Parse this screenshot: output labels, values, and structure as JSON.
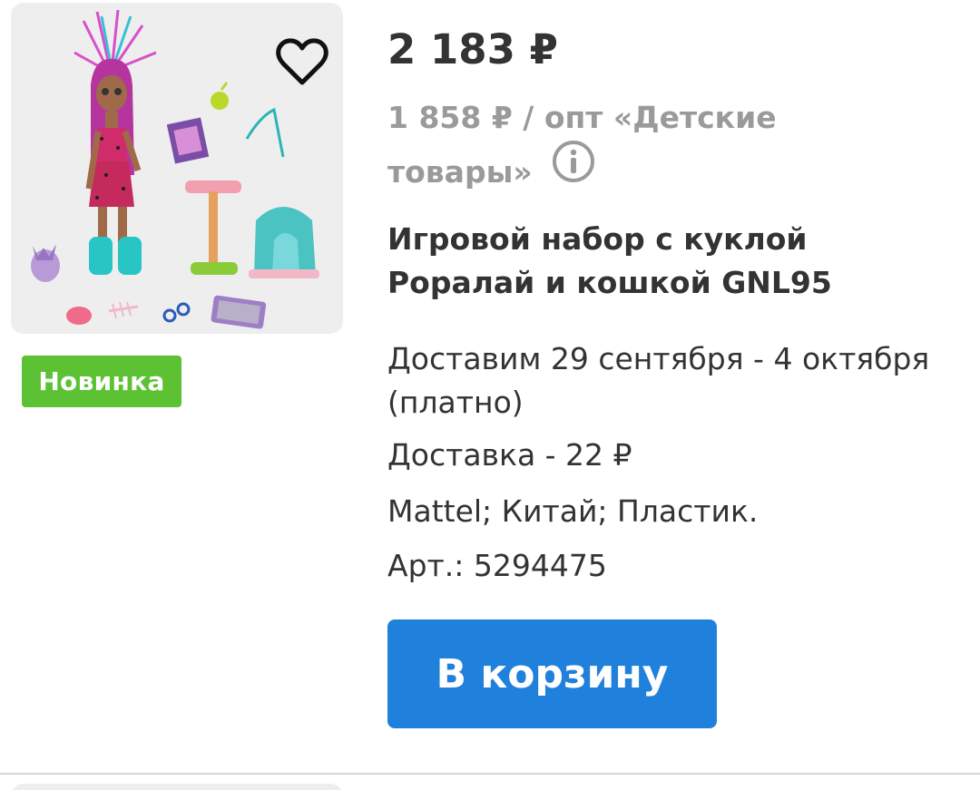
{
  "product": {
    "price": "2 183 ₽",
    "wholesale_line1": "1 858 ₽ / опт «Детские",
    "wholesale_line2": "товары»",
    "title": "Игровой набор с куклой Роралай и кошкой GNL95",
    "delivery": "Доставим 29 сентября - 4 октября (платно)",
    "delivery_cost": "Доставка - 22 ₽",
    "properties": "Mattel; Китай; Пластик.",
    "sku": "Арт.: 5294475",
    "badge": "Новинка",
    "cart_button": "В корзину"
  },
  "icons": {
    "favorite": "heart-outline-icon",
    "info": "info-circle-icon"
  },
  "colors": {
    "badge": "#5cc133",
    "button": "#2081dc",
    "muted_text": "#9a9a9a"
  }
}
